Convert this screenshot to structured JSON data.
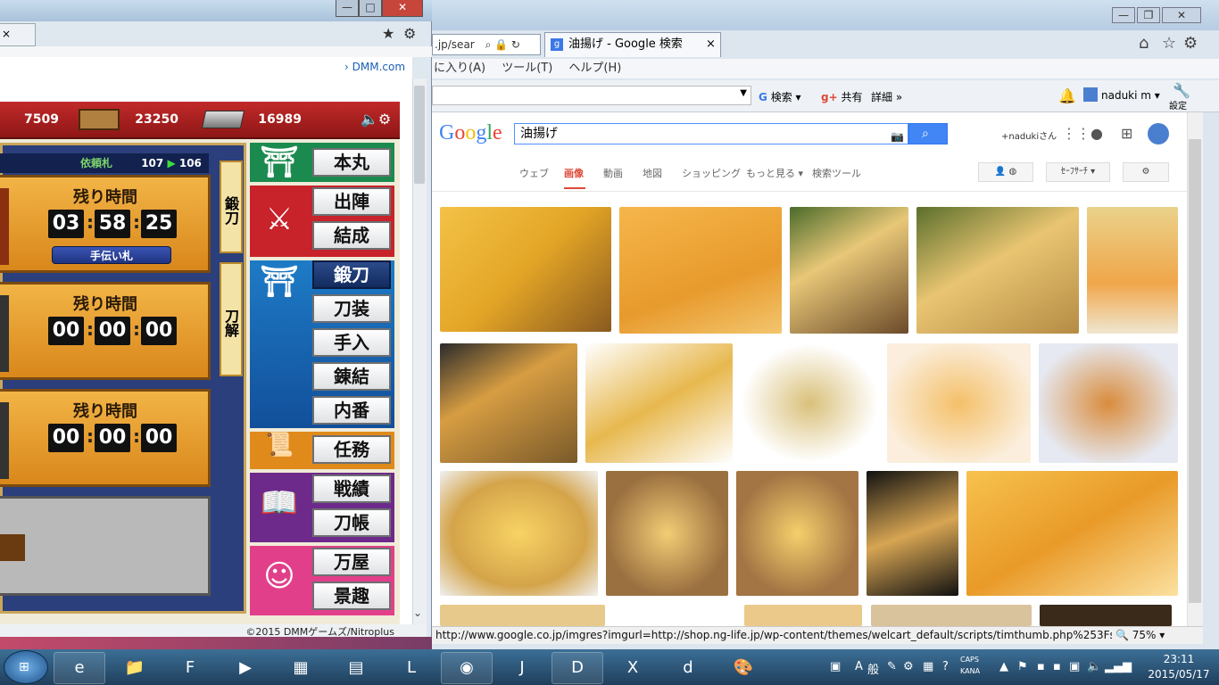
{
  "left_window": {
    "tab_star": "★",
    "tab_gear": "⚙",
    "link_text": "DMM.com",
    "footer": "©2015 DMMゲームズ/Nitroplus"
  },
  "game": {
    "resources": [
      "7509",
      "23250",
      "16989"
    ],
    "request_label": "依頼札",
    "request_count": "107",
    "request_next": "106",
    "slots": [
      {
        "label": "残り時間",
        "h": "03",
        "m": "58",
        "s": "25"
      },
      {
        "label": "残り時間",
        "h": "00",
        "m": "00",
        "s": "00"
      },
      {
        "label": "残り時間",
        "h": "00",
        "m": "00",
        "s": "00"
      }
    ],
    "help_button": "手伝い札",
    "side_tabs": [
      "鍛刀",
      "刀解"
    ],
    "menu": [
      "本丸",
      "出陣",
      "結成",
      "鍛刀",
      "刀装",
      "手入",
      "錬結",
      "内番",
      "任務",
      "戦績",
      "刀帳",
      "万屋",
      "景趣"
    ]
  },
  "right_window": {
    "address_fragment": ".jp/sear",
    "tab_title": "油揚げ - Google 検索",
    "menubar": [
      "に入り(A)",
      "ツール(T)",
      "ヘルプ(H)"
    ],
    "cmd": {
      "search": "検索",
      "share": "共有",
      "details": "詳細"
    },
    "user": "naduki m",
    "settings_label": "設定",
    "google_logo": "Google",
    "query": "油揚げ",
    "user_link": "+nadukiさん",
    "nav": [
      "ウェブ",
      "画像",
      "動画",
      "地図",
      "ショッピング",
      "もっと見る ▾",
      "検索ツール"
    ],
    "safesearch": "ｾｰﾌｻｰﾁ ▾",
    "status_url": "http://www.google.co.jp/imgres?imgurl=http://shop.ng-life.jp/wp-content/themes/welcart_default/scripts/timthumb.php%253Fs",
    "zoom": "75%"
  },
  "taskbar": {
    "ime": [
      "A",
      "般"
    ],
    "caps": "CAPS",
    "kana": "KANA",
    "time": "23:11",
    "date": "2015/05/17"
  }
}
